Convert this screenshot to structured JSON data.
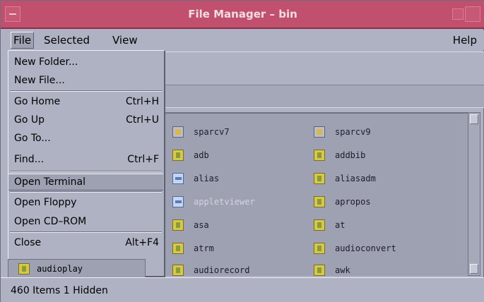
{
  "window": {
    "title": "File Manager – bin"
  },
  "menubar": {
    "file": "File",
    "selected": "Selected",
    "view": "View",
    "help": "Help"
  },
  "file_menu": {
    "items": [
      {
        "label": "New Folder...",
        "accel": ""
      },
      {
        "label": "New File...",
        "accel": ""
      },
      {
        "label": "Go Home",
        "accel": "Ctrl+H"
      },
      {
        "label": "Go Up",
        "accel": "Ctrl+U"
      },
      {
        "label": "Go To...",
        "accel": ""
      },
      {
        "label": "Find...",
        "accel": "Ctrl+F"
      },
      {
        "label": "Open Terminal",
        "accel": ""
      },
      {
        "label": "Open Floppy",
        "accel": ""
      },
      {
        "label": "Open CD–ROM",
        "accel": ""
      },
      {
        "label": "Close",
        "accel": "Alt+F4"
      }
    ],
    "highlighted": "Open Terminal"
  },
  "files": [
    {
      "name": "sparcv7",
      "icon": "folder-icon"
    },
    {
      "name": "sparcv9",
      "icon": "folder-icon"
    },
    {
      "name": "adb",
      "icon": "executable-icon"
    },
    {
      "name": "addbib",
      "icon": "executable-icon"
    },
    {
      "name": "alias",
      "icon": "link-icon"
    },
    {
      "name": "aliasadm",
      "icon": "executable-icon"
    },
    {
      "name": "appletviewer",
      "icon": "link-icon"
    },
    {
      "name": "apropos",
      "icon": "executable-icon"
    },
    {
      "name": "asa",
      "icon": "executable-icon"
    },
    {
      "name": "at",
      "icon": "executable-icon"
    },
    {
      "name": "atrm",
      "icon": "executable-icon"
    },
    {
      "name": "audioconvert",
      "icon": "executable-icon"
    },
    {
      "name": "audiorecord",
      "icon": "executable-icon"
    },
    {
      "name": "awk",
      "icon": "executable-icon"
    }
  ],
  "peek_file": {
    "name": "audioplay",
    "icon": "executable-icon"
  },
  "status": {
    "text": "460 Items 1 Hidden"
  },
  "colors": {
    "titlebar": "#c0506e",
    "background": "#aeb2c3",
    "pane": "#9ea1b1"
  }
}
